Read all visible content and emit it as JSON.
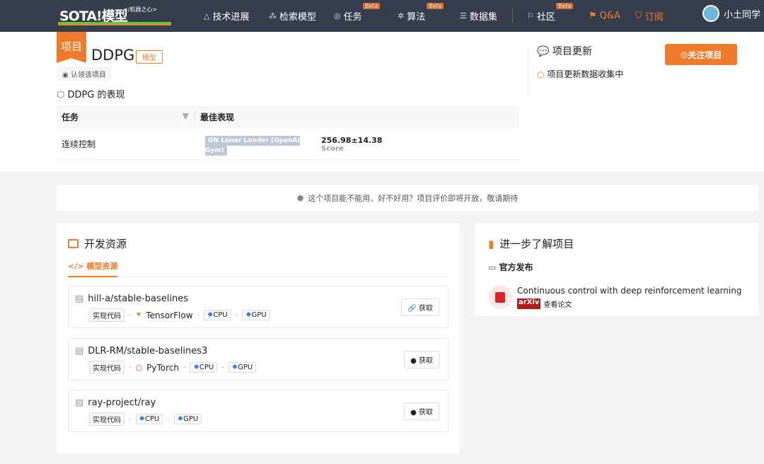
{
  "header": {
    "logo": "SOTA!模型",
    "logo_sub": "</机器之心>",
    "nav": [
      {
        "label": "技术进展",
        "icon": "lamp-icon"
      },
      {
        "label": "检索模型",
        "icon": "nodes-icon"
      },
      {
        "label": "任务",
        "icon": "layers-icon",
        "badge": "Beta"
      },
      {
        "label": "算法",
        "icon": "atom-icon",
        "badge": "Beta"
      },
      {
        "label": "数据集",
        "icon": "database-icon"
      },
      {
        "label": "社区",
        "icon": "flag-icon",
        "badge": "Beta"
      },
      {
        "label": "Q&A",
        "icon": "qa-icon"
      },
      {
        "label": "订阅",
        "icon": "bookmark-icon"
      }
    ],
    "user": "小土同学"
  },
  "project": {
    "ribbon": "项目",
    "title": "DDPG",
    "tag": "模型",
    "claim": "认领该项目",
    "perf_title": "DDPG 的表现",
    "columns": [
      "任务",
      "最佳表现"
    ],
    "rows": [
      {
        "task": "连续控制",
        "dataset": "ON Lunar Lander (OpenAI Gym)",
        "value": "256.98±14.38",
        "metric": "Score"
      }
    ]
  },
  "updates": {
    "title": "项目更新",
    "status": "项目更新数据收集中",
    "follow": "关注项目"
  },
  "notice": "这个项目能不能用、好不好用？项目评价即将开放，敬请期待",
  "resources": {
    "title": "开发资源",
    "tab": "模型资源",
    "repos": [
      {
        "name": "hill-a/stable-baselines",
        "type": "实现代码",
        "framework": "TensorFlow",
        "hw": [
          "CPU",
          "GPU"
        ],
        "action": "获取"
      },
      {
        "name": "DLR-RM/stable-baselines3",
        "type": "实现代码",
        "framework": "PyTorch",
        "hw": [
          "CPU",
          "GPU"
        ],
        "action": "获取"
      },
      {
        "name": "ray-project/ray",
        "type": "实现代码",
        "framework": "",
        "hw": [
          "CPU",
          "GPU"
        ],
        "action": "获取"
      }
    ]
  },
  "learn": {
    "title": "进一步了解项目",
    "section": "官方发布",
    "paper": "Continuous control with deep reinforcement learning",
    "source": "arXiv",
    "link": "查看论文"
  },
  "colors": {
    "accent": "#f07a2b",
    "header": "#363e4d"
  }
}
